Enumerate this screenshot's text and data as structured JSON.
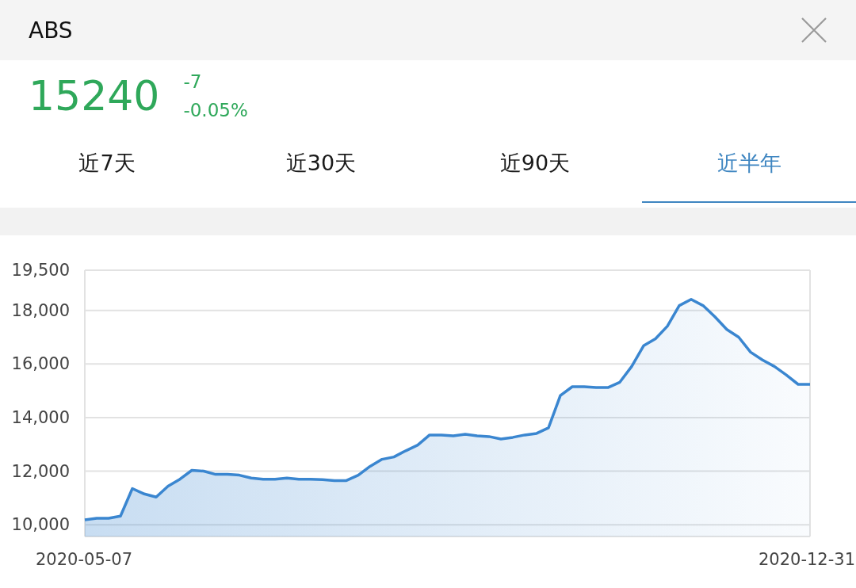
{
  "header": {
    "title": "ABS"
  },
  "quote": {
    "price": "15240",
    "change": "-7",
    "change_percent": "-0.05%"
  },
  "tabs": [
    {
      "label": "近7天",
      "selected": false
    },
    {
      "label": "近30天",
      "selected": false
    },
    {
      "label": "近90天",
      "selected": false
    },
    {
      "label": "近半年",
      "selected": true
    }
  ],
  "chart": {
    "chart_data": {
      "type": "area",
      "ylim": [
        9560,
        19500
      ],
      "yticks": [
        {
          "value": 10000,
          "label": "10,000"
        },
        {
          "value": 12000,
          "label": "12,000"
        },
        {
          "value": 14000,
          "label": "14,000"
        },
        {
          "value": 16000,
          "label": "16,000"
        },
        {
          "value": 18000,
          "label": "18,000"
        },
        {
          "value": 19500,
          "label": "19,500"
        }
      ],
      "grid": true,
      "series": [
        {
          "color": "#3a86d0",
          "values": [
            10180,
            10240,
            10240,
            10320,
            11350,
            11150,
            11030,
            11440,
            11700,
            12030,
            12000,
            11880,
            11880,
            11850,
            11740,
            11700,
            11700,
            11740,
            11700,
            11700,
            11680,
            11650,
            11650,
            11850,
            12180,
            12440,
            12530,
            12760,
            12970,
            13350,
            13350,
            13320,
            13380,
            13320,
            13290,
            13200,
            13260,
            13350,
            13410,
            13620,
            14820,
            15150,
            15150,
            15120,
            15120,
            15320,
            15910,
            16680,
            16940,
            17410,
            18180,
            18410,
            18180,
            17760,
            17290,
            17000,
            16440,
            16150,
            15910,
            15590,
            15240,
            15240
          ]
        }
      ]
    },
    "x_axis_labels": [
      "2020-05-07",
      "2020-12-31"
    ]
  }
}
